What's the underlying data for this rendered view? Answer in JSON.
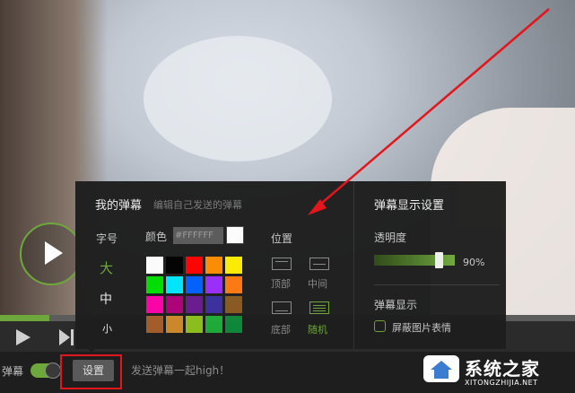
{
  "panel": {
    "my_danmu_title": "我的弹幕",
    "my_danmu_subtitle": "编辑自己发送的弹幕",
    "font_size_label": "字号",
    "sizes": {
      "large": "大",
      "medium": "中",
      "small": "小"
    },
    "color_label": "颜色",
    "color_hex": "#FFFFFF",
    "palette": [
      "#ffffff",
      "#000000",
      "#ff0000",
      "#ff8c00",
      "#ffee00",
      "#00e000",
      "#00e8ff",
      "#0060ff",
      "#9b2cff",
      "#ff7a10",
      "#ff00a8",
      "#b0007a",
      "#6a1a8e",
      "#3a2f9e",
      "#8a5a20",
      "#a65f2a",
      "#d08a2c",
      "#8fc21e",
      "#1fae3a",
      "#0f8a3a"
    ],
    "selected_color": "#ffffff",
    "position_label": "位置",
    "positions": {
      "top": "顶部",
      "middle": "中间",
      "bottom": "底部",
      "random": "随机"
    },
    "selected_position": "random",
    "display_settings_title": "弹幕显示设置",
    "opacity_label": "透明度",
    "opacity_value": "90%",
    "opacity_level": 0.9,
    "danmu_display_label": "弹幕显示",
    "block_image_emoji_label": "屏蔽图片表情"
  },
  "bottom_bar": {
    "danmu_label": "弹幕",
    "settings_button": "设置",
    "input_placeholder": "发送弹幕一起high！"
  },
  "watermark": {
    "text": "系统之家",
    "subtext": "XITONGZHIJIA.NET"
  },
  "colors": {
    "accent": "#6ea83c",
    "annotation": "#e3161b"
  }
}
